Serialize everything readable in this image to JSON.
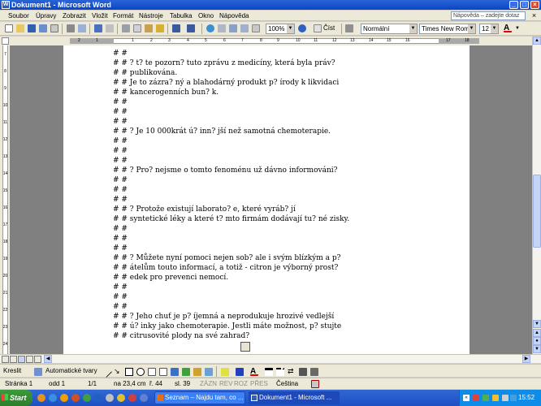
{
  "window": {
    "title": "Dokument1 - Microsoft Word"
  },
  "menu": {
    "items": [
      "Soubor",
      "Úpravy",
      "Zobrazit",
      "Vložit",
      "Formát",
      "Nástroje",
      "Tabulka",
      "Okno",
      "Nápověda"
    ],
    "help_placeholder": "Nápověda – zadejte dotaz"
  },
  "toolbar": {
    "zoom": "100%",
    "read_label": "Číst",
    "style": "Normální",
    "font": "Times New Roman",
    "size": "12"
  },
  "ruler": {
    "ticks": [
      "2",
      "1",
      "1",
      "2",
      "3",
      "4",
      "5",
      "6",
      "7",
      "8",
      "9",
      "10",
      "11",
      "12",
      "13",
      "14",
      "15",
      "16",
      "17",
      "18"
    ]
  },
  "vruler": {
    "ticks": [
      "7",
      "8",
      "9",
      "10",
      "11",
      "12",
      "13",
      "14",
      "15",
      "16",
      "17",
      "18",
      "19",
      "20",
      "21",
      "22",
      "23",
      "24"
    ]
  },
  "document": {
    "lines": [
      "# #",
      "# # ? t? te pozorn? tuto zprávu z medicíny, která byla práv?",
      "# # publikována.",
      "# # Je to zázra? ný a blahodárný produkt p? írody k likvidaci",
      "# # kancerogenních bun? k.",
      "# #",
      "# #",
      "# #",
      "# # ? Je 10 000krát ú? inn? jší než samotná chemoterapie.",
      "# #",
      "# #",
      "# #",
      "# # ? Pro? nejsme o tomto fenoménu už dávno informováni?",
      "# #",
      "# #",
      "# #",
      "# # ? Protože existují laborato? e, které vyráb? jí",
      "# # syntetické léky a které t? mto firmám dodávají tu? né zisky.",
      "# #",
      "# #",
      "# #",
      "# # ? Můžete nyní pomoci nejen sob? ale i svým blízkým a p?",
      "# # átelům touto informací, a totiž - citron je výborný prost?",
      "# # edek pro prevenci nemocí.",
      "# #",
      "# #",
      "# #",
      "# # ? Jeho chuť je p? íjemná a neprodukuje hrozivé vedlejší",
      "# # ú? inky jako chemoterapie. Jestli máte možnost, p? stujte",
      "# # citrusovité plody na své zahrad?"
    ]
  },
  "drawing": {
    "draw_label": "Kreslit",
    "autoshapes_label": "Automatické tvary"
  },
  "status": {
    "page": "Stránka  1",
    "section": "odd  1",
    "pages": "1/1",
    "position": "na 23,4 cm",
    "line": "ř.  44",
    "column": "sl.  39",
    "rec": "ZÁZN",
    "trk": "REV",
    "ext": "ROZ",
    "ovr": "PŘES",
    "language": "Čeština"
  },
  "taskbar": {
    "start_label": "Start",
    "tasks": [
      "Seznam – Najdu tam, co ...",
      "Dokument1 - Microsoft ..."
    ],
    "clock": "15:52"
  },
  "colors": {
    "titlebar": "#0a46c4",
    "taskbar": "#1e4fc4",
    "start": "#2c7f2c",
    "spell_underline": "#ff0000"
  }
}
